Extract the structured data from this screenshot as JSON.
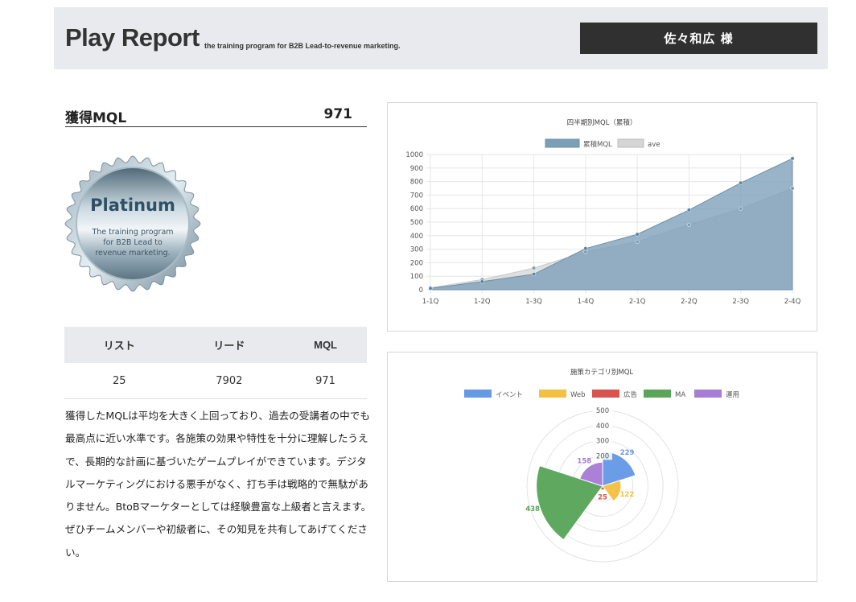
{
  "header": {
    "title": "Play Report",
    "subtitle": "the training program for B2B Lead-to-revenue marketing.",
    "user_name": "佐々和広 様"
  },
  "summary": {
    "label": "獲得MQL",
    "value": "971"
  },
  "badge": {
    "rank": "Platinum",
    "tagline": [
      "The training program",
      "for B2B Lead to",
      "revenue marketing."
    ]
  },
  "stats": {
    "headers": [
      "リスト",
      "リード",
      "MQL"
    ],
    "values": [
      "25",
      "7902",
      "971"
    ]
  },
  "comment": "獲得したMQLは平均を大きく上回っており、過去の受講者の中でも最高点に近い水準です。各施策の効果や特性を十分に理解したうえで、長期的な計画に基づいたゲームプレイができています。デジタルマーケティングにおける悪手がなく、打ち手は戦略的で無駄がありません。BtoBマーケターとしては経験豊富な上級者と言えます。ぜひチームメンバーや初級者に、その知見を共有してあげてください。",
  "colors": {
    "cumulative": "#7c9fb8",
    "average": "#d5d5d5",
    "header_bg": "#e9eaed",
    "user_bg": "#303030"
  },
  "chart_data": [
    {
      "type": "area",
      "title": "四半期別MQL（累積）",
      "categories": [
        "1-1Q",
        "1-2Q",
        "1-3Q",
        "1-4Q",
        "2-1Q",
        "2-2Q",
        "2-3Q",
        "2-4Q"
      ],
      "series": [
        {
          "name": "累積MQL",
          "values": [
            10,
            60,
            115,
            305,
            410,
            590,
            790,
            971
          ],
          "color": "#7c9fb8"
        },
        {
          "name": "ave",
          "values": [
            15,
            75,
            160,
            280,
            355,
            480,
            600,
            750
          ],
          "color": "#d5d5d5"
        }
      ],
      "yticks": [
        0,
        100,
        200,
        300,
        400,
        500,
        600,
        700,
        800,
        900,
        1000
      ],
      "ylim": [
        0,
        1000
      ],
      "legend": "top",
      "grid": true
    },
    {
      "type": "polarArea",
      "title": "施策カテゴリ別MQL",
      "categories": [
        "イベント",
        "Web",
        "広告",
        "MA",
        "運用"
      ],
      "values": [
        229,
        122,
        25,
        438,
        158
      ],
      "colors": [
        "#6699e6",
        "#f4c042",
        "#d9534f",
        "#5aa55a",
        "#a87dd6"
      ],
      "rticks": [
        200,
        300,
        400,
        500
      ],
      "rlim": [
        0,
        500
      ],
      "legend": "top"
    }
  ]
}
